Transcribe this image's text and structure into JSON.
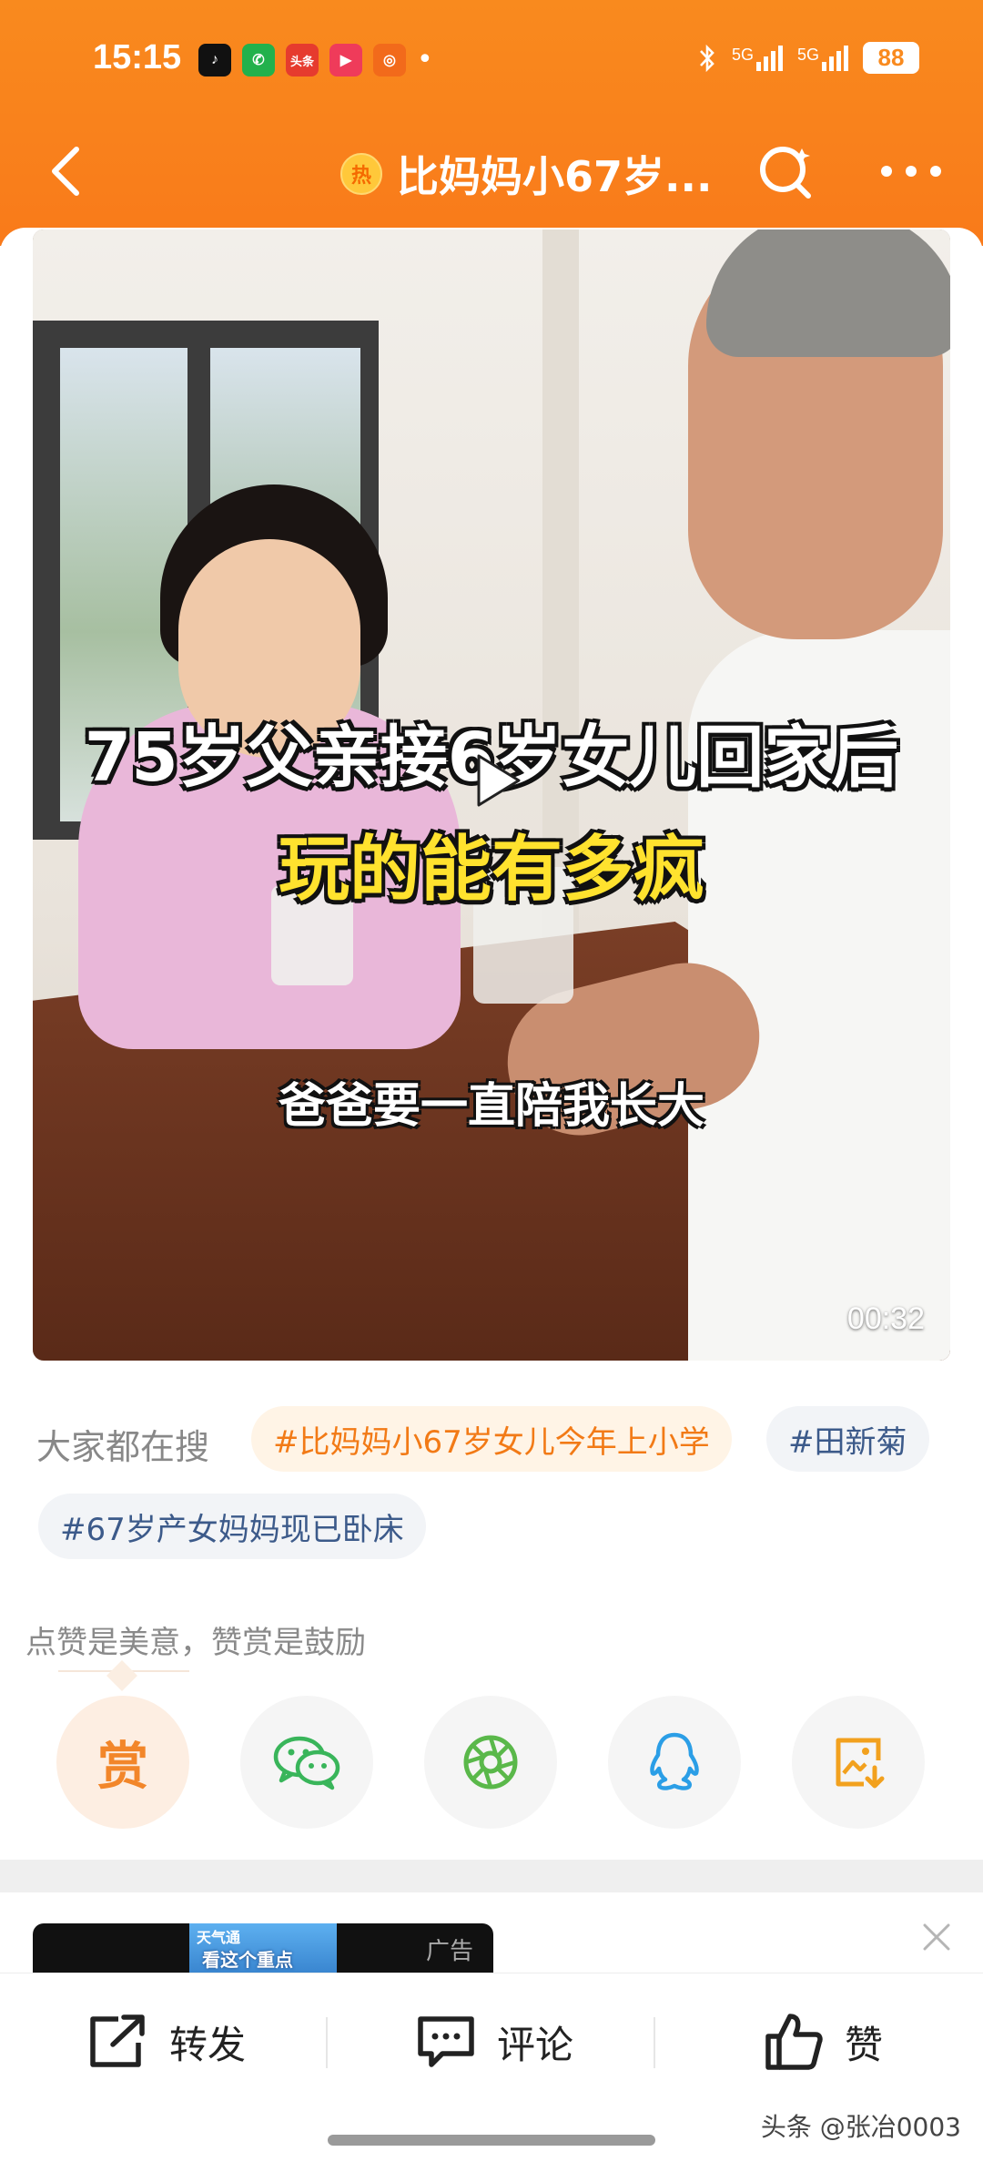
{
  "status_bar": {
    "time": "15:15",
    "apps": [
      {
        "icon": "tiktok-icon",
        "label": "♪",
        "color": "#111111"
      },
      {
        "icon": "wechat-icon",
        "label": "✆",
        "color": "#22b14c"
      },
      {
        "icon": "toutiao-icon",
        "label": "头条",
        "color": "#e63b2e"
      },
      {
        "icon": "video-app-icon",
        "label": "▶",
        "color": "#ef3b5a"
      },
      {
        "icon": "app-icon",
        "label": "◎",
        "color": "#f26a1b"
      }
    ],
    "dot": "•",
    "signal1": "5G",
    "signal2": "5G",
    "battery": "88"
  },
  "nav": {
    "hot_badge": "热",
    "title": "比妈妈小67岁..."
  },
  "video": {
    "caption_line1": "75岁父亲接6岁女儿回家后",
    "caption_line2": "玩的能有多疯",
    "caption_line3": "爸爸要一直陪我长大",
    "duration": "00:32"
  },
  "search": {
    "label": "大家都在搜",
    "tags": [
      {
        "text": "#比妈妈小67岁女儿今年上小学",
        "style": "hot"
      },
      {
        "text": "#田新菊",
        "style": "normal"
      },
      {
        "text": "#67岁产女妈妈现已卧床",
        "style": "normal"
      }
    ]
  },
  "praise": {
    "hint": "点赞是美意，赞赏是鼓励",
    "reward_label": "赏",
    "share_targets": [
      "wechat-icon",
      "moments-icon",
      "qq-icon",
      "save-image-icon"
    ]
  },
  "ad": {
    "thumb_line1": "天气通",
    "thumb_line2": "看这个重点",
    "label": "广告"
  },
  "bottom_bar": {
    "forward": "转发",
    "comment": "评论",
    "like": "赞"
  },
  "watermark": "头条 @张冶0003",
  "colors": {
    "brand_orange": "#f98a1e",
    "tag_hot_text": "#f27a16",
    "tag_normal_text": "#3c5a8a"
  }
}
